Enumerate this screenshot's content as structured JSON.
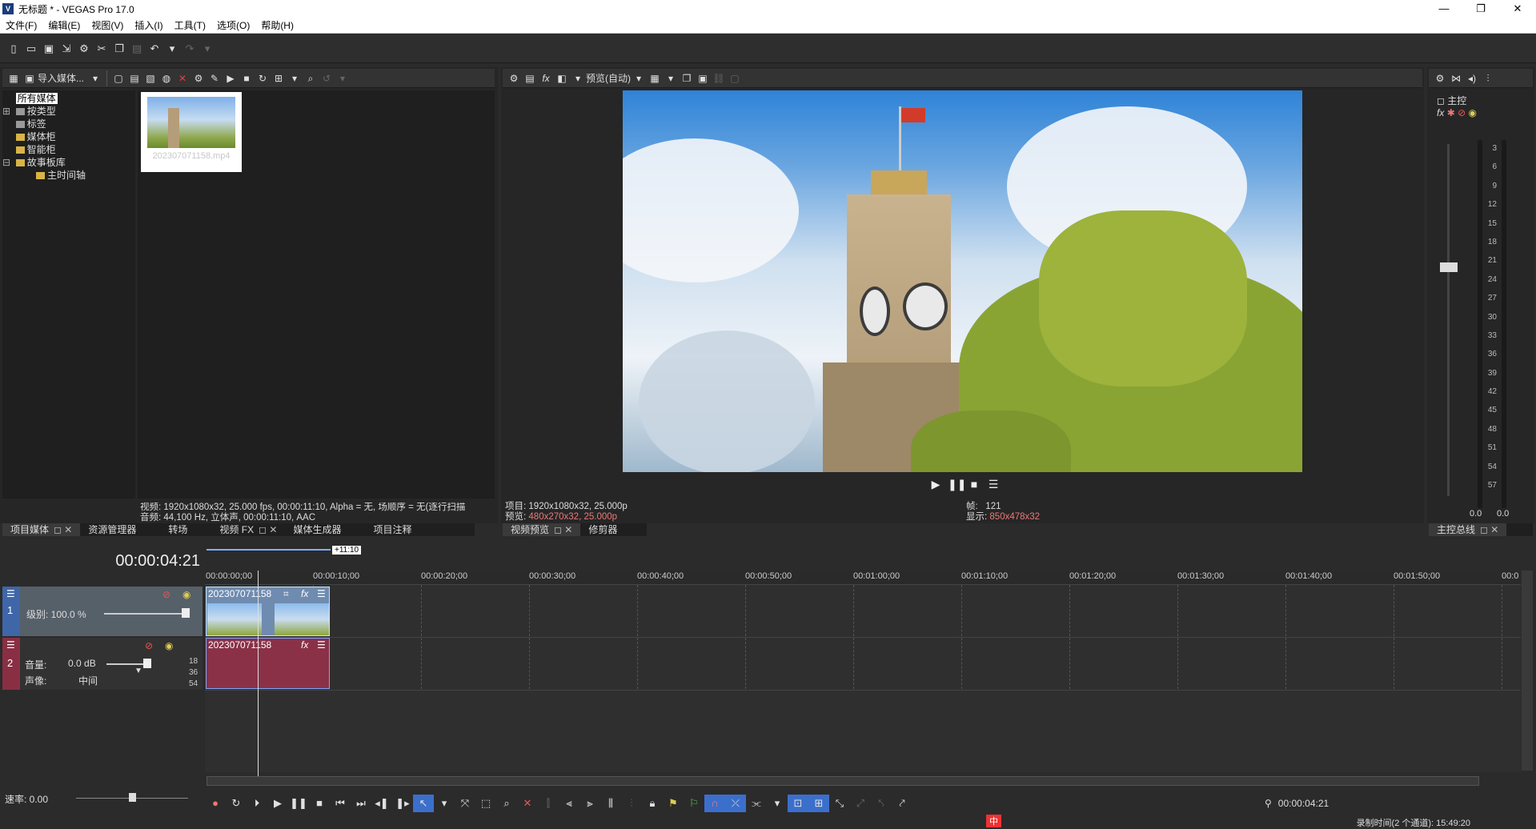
{
  "window": {
    "title": "无标题 * - VEGAS Pro 17.0",
    "app_icon": "V",
    "controls": [
      "—",
      "❐",
      "✕"
    ]
  },
  "menu": [
    "文件(F)",
    "编辑(E)",
    "视图(V)",
    "插入(I)",
    "工具(T)",
    "选项(O)",
    "帮助(H)"
  ],
  "media_panel": {
    "import_label": "导入媒体...",
    "tree": [
      "所有媒体",
      "按类型",
      "标签",
      "媒体柜",
      "智能柜",
      "故事板库",
      "主时间轴"
    ],
    "thumb_name": "202307071158.mp4",
    "video_info": "视频: 1920x1080x32, 25.000 fps, 00:00:11:10, Alpha = 无, 场顺序 = 无(逐行扫描",
    "audio_info": "音频: 44,100 Hz, 立体声, 00:00:11:10, AAC"
  },
  "left_tabs": [
    "项目媒体",
    "资源管理器",
    "转场",
    "视频 FX",
    "媒体生成器",
    "项目注释"
  ],
  "preview_panel": {
    "quality": "预览(自动)",
    "project_label": "项目:",
    "project_value": "1920x1080x32, 25.000p",
    "preview_label": "预览:",
    "preview_value": "480x270x32, 25.000p",
    "frame_label": "帧:",
    "frame_value": "121",
    "display_label": "显示:",
    "display_value": "850x478x32",
    "tabs": [
      "视频预览",
      "修剪器"
    ]
  },
  "master": {
    "label": "主控",
    "scale": [
      "3",
      "6",
      "9",
      "12",
      "15",
      "18",
      "21",
      "24",
      "27",
      "30",
      "33",
      "36",
      "39",
      "42",
      "45",
      "48",
      "51",
      "54",
      "57"
    ],
    "left_value": "0.0",
    "right_value": "0.0",
    "tab": "主控总线"
  },
  "timeline": {
    "timecode": "00:00:04:21",
    "loop_marker": "+11:10",
    "ruler": [
      "00:00:00;00",
      "00:00:10;00",
      "00:00:20;00",
      "00:00:30;00",
      "00:00:40;00",
      "00:00:50;00",
      "00:01:00;00",
      "00:01:10;00",
      "00:01:20;00",
      "00:01:30;00",
      "00:01:40;00",
      "00:01:50;00",
      "00:0"
    ],
    "track1": {
      "num": "1",
      "level": "级别: 100.0 %",
      "clip": "202307071158"
    },
    "track2": {
      "num": "2",
      "volume_label": "音量:",
      "volume_value": "0.0 dB",
      "pan_label": "声像:",
      "pan_value": "中间",
      "db_marks": [
        "18",
        "36",
        "54"
      ],
      "clip": "202307071158"
    },
    "rate": "速率: 0.00",
    "cursor_time": "00:00:04:21"
  },
  "status": {
    "record_time": "录制时间(2 个通道): 15:49:20",
    "ime": "中"
  }
}
